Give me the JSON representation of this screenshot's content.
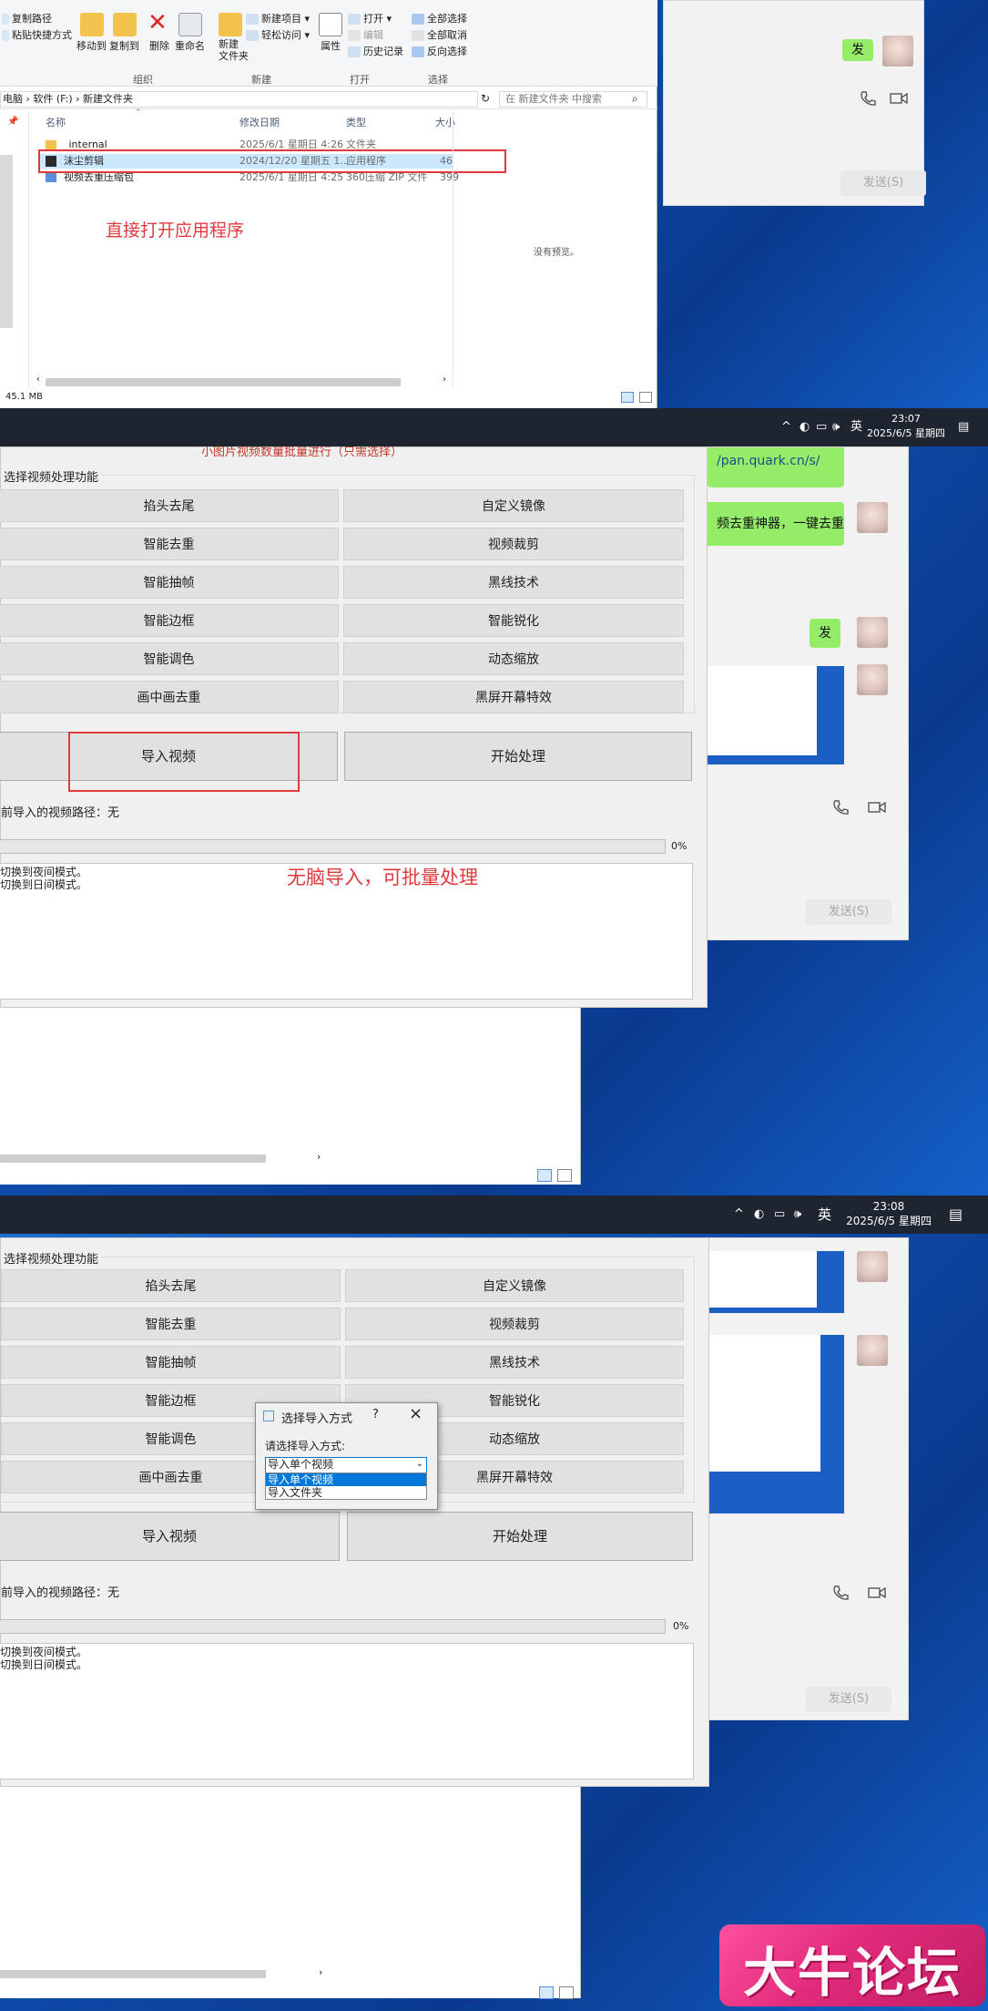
{
  "explorer": {
    "ribbon": {
      "copy_path": "复制路径",
      "paste_shortcut": "粘贴快捷方式",
      "move_to": "移动到",
      "copy_to": "复制到",
      "delete": "删除",
      "rename": "重命名",
      "new_folder": "新建\n文件夹",
      "new_item": "新建项目 ▾",
      "easy_access": "轻松访问 ▾",
      "properties": "属性",
      "open": "打开 ▾",
      "edit": "编辑",
      "history": "历史记录",
      "select_all": "全部选择",
      "select_none": "全部取消",
      "invert_selection": "反向选择",
      "group_organize": "组织",
      "group_new": "新建",
      "group_open": "打开",
      "group_select": "选择"
    },
    "address": "电脑 › 软件 (F:) › 新建文件夹",
    "search_placeholder": "在 新建文件夹 中搜索",
    "columns": {
      "name": "名称",
      "date": "修改日期",
      "type": "类型",
      "size": "大小"
    },
    "files": [
      {
        "name": "_internal",
        "date": "2025/6/1 星期日 4:26",
        "type": "文件夹",
        "size": ""
      },
      {
        "name": "沫尘剪辑",
        "date": "2024/12/20 星期五 1...",
        "type": "应用程序",
        "size": "46"
      },
      {
        "name": "视频去重压缩包",
        "date": "2025/6/1 星期日 4:25",
        "type": "360压缩 ZIP 文件",
        "size": "399"
      }
    ],
    "no_preview": "没有预览。",
    "status": "45.1 MB",
    "annotation": "直接打开应用程序"
  },
  "taskbar": [
    {
      "ime": "英",
      "time": "23:07",
      "date": "2025/6/5 星期四"
    },
    {
      "ime": "英",
      "time": "23:08",
      "date": "2025/6/5 星期四"
    }
  ],
  "chat": {
    "bubble_send": "发",
    "bubble_link": "/pan.quark.cn/s/",
    "bubble_tool": "频去重神器，一键去重",
    "send_button": "发送(S)"
  },
  "tool": {
    "partial_title": "小图片视频数量批量进行（只需选择）",
    "frame_title": "选择视频处理功能",
    "functions": [
      [
        "掐头去尾",
        "自定义镜像"
      ],
      [
        "智能去重",
        "视频裁剪"
      ],
      [
        "智能抽帧",
        "黑线技术"
      ],
      [
        "智能边框",
        "智能锐化"
      ],
      [
        "智能调色",
        "动态缩放"
      ],
      [
        "画中画去重",
        "黑屏开幕特效"
      ]
    ],
    "import_button": "导入视频",
    "start_button": "开始处理",
    "path_label": "前导入的视频路径：无",
    "path_label_3": "前导入的视频路径：无",
    "progress_percent": "0%",
    "progress_value": 0,
    "log_lines": [
      "切换到夜间模式。",
      "切换到日间模式。"
    ],
    "annotation": "无脑导入，可批量处理"
  },
  "dialog": {
    "title": "选择导入方式",
    "help": "?",
    "close": "×",
    "prompt": "请选择导入方式:",
    "selected": "导入单个视频",
    "options": [
      "导入单个视频",
      "导入文件夹"
    ]
  },
  "watermark": "大牛论坛"
}
